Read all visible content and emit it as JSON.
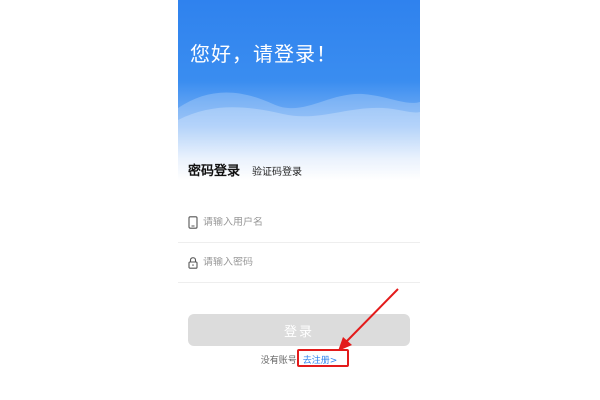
{
  "header": {
    "greeting": "您好，请登录！"
  },
  "tabs": {
    "password_login": "密码登录",
    "code_login": "验证码登录"
  },
  "form": {
    "username_placeholder": "请输入用户名",
    "password_placeholder": "请输入密码",
    "submit_label": "登录"
  },
  "register": {
    "prompt": "没有账号",
    "link_label": "去注册>"
  },
  "colors": {
    "brand_blue": "#2f82ee",
    "button_disabled": "#dcdcdc",
    "annotation_red": "#e31b1b"
  },
  "icons": {
    "username": "phone-icon",
    "password": "lock-icon"
  }
}
